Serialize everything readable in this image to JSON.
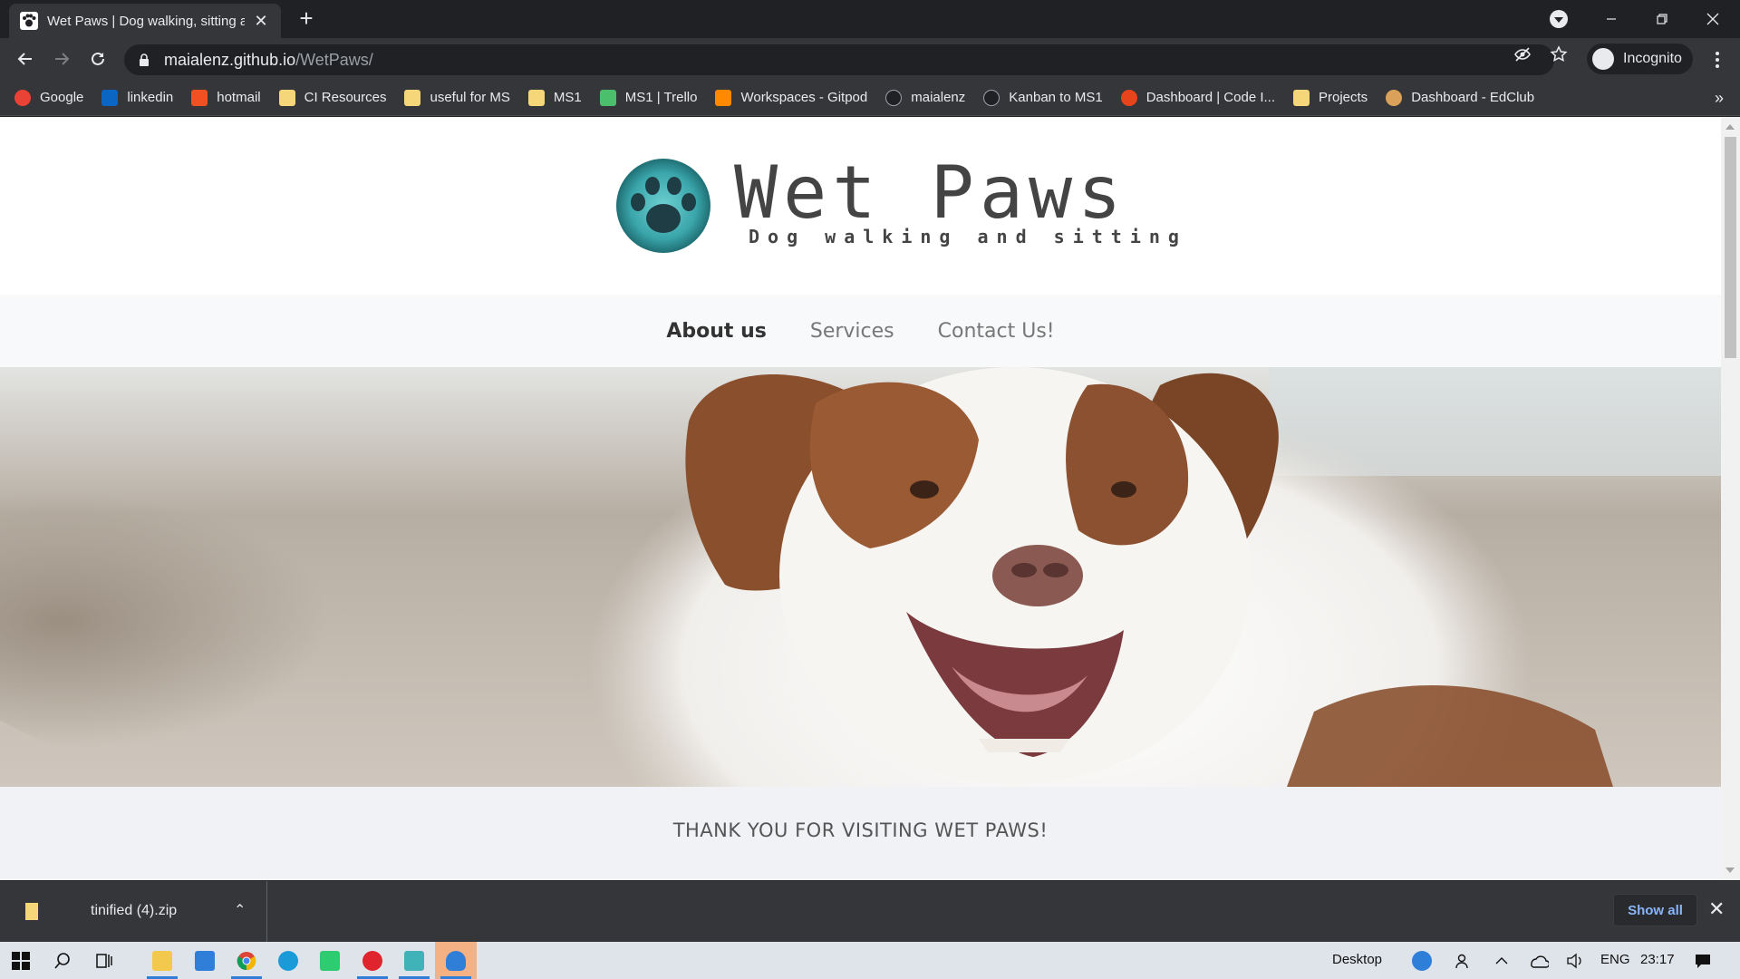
{
  "browser": {
    "tab_title": "Wet Paws | Dog walking, sitting a",
    "url_host": "maialenz.github.io",
    "url_path": "/WetPaws/",
    "incognito_label": "Incognito",
    "bookmarks": [
      {
        "label": "Google",
        "icon": "google-icon",
        "color": "#ea4335"
      },
      {
        "label": "linkedin",
        "icon": "linkedin-icon",
        "color": "#0a66c2"
      },
      {
        "label": "hotmail",
        "icon": "microsoft-icon",
        "color": "#f25022"
      },
      {
        "label": "CI Resources",
        "icon": "folder-icon",
        "color": "#f5d77a"
      },
      {
        "label": "useful for MS",
        "icon": "folder-icon",
        "color": "#f5d77a"
      },
      {
        "label": "MS1",
        "icon": "folder-icon",
        "color": "#f5d77a"
      },
      {
        "label": "MS1 | Trello",
        "icon": "trello-icon",
        "color": "#4bbf6b"
      },
      {
        "label": "Workspaces - Gitpod",
        "icon": "gitpod-icon",
        "color": "#ff8a00"
      },
      {
        "label": "maialenz",
        "icon": "github-icon",
        "color": "#202124"
      },
      {
        "label": "Kanban to MS1",
        "icon": "github-icon",
        "color": "#202124"
      },
      {
        "label": "Dashboard | Code I...",
        "icon": "codeinstitute-icon",
        "color": "#e8441b"
      },
      {
        "label": "Projects",
        "icon": "folder-icon",
        "color": "#f5d77a"
      },
      {
        "label": "Dashboard - EdClub",
        "icon": "edclub-icon",
        "color": "#d9a15a"
      }
    ]
  },
  "site": {
    "brand_name": "Wet Paws",
    "tagline": "Dog walking and sitting",
    "nav": [
      {
        "label": "About us",
        "active": true
      },
      {
        "label": "Services",
        "active": false
      },
      {
        "label": "Contact Us!",
        "active": false
      }
    ],
    "welcome_heading": "THANK YOU FOR VISITING WET PAWS!",
    "colors": {
      "paw_teal": "#3fb3b8",
      "paw_dark": "#1f3d44"
    }
  },
  "downloads": {
    "file_name": "tinified (4).zip",
    "show_all_label": "Show all"
  },
  "taskbar": {
    "desktop_label": "Desktop",
    "language": "ENG",
    "time": "23:17"
  }
}
